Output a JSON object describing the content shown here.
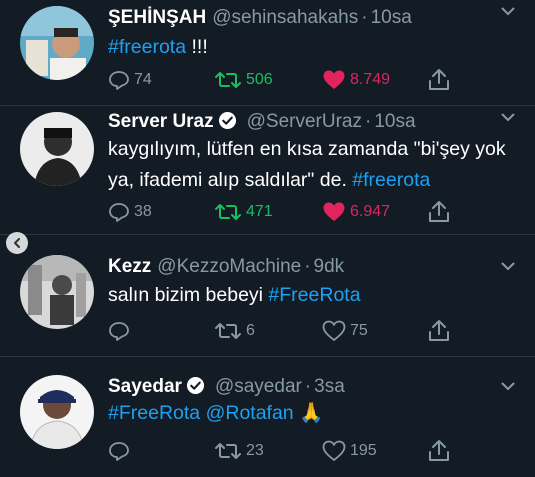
{
  "tweets": [
    {
      "name": "ŞEHİNŞAH",
      "handle": "@sehinsahakahs",
      "sep": "·",
      "time": "10sa",
      "verified": false,
      "text_plain": "",
      "text_tag": "#freerota",
      "text_suffix": " !!!",
      "reply_count": "74",
      "retweet_count": "506",
      "like_count": "8.749",
      "retweeted": true,
      "liked": true
    },
    {
      "name": "Server Uraz",
      "handle": "@ServerUraz",
      "sep": "·",
      "time": "10sa",
      "verified": true,
      "text_plain": "kaygılıyım, lütfen en kısa zamanda \"bi'şey yok ya, ifademi alıp saldılar\" de. ",
      "text_tag": "#freerota",
      "text_suffix": "",
      "reply_count": "38",
      "retweet_count": "471",
      "like_count": "6.947",
      "retweeted": true,
      "liked": true
    },
    {
      "name": "Kezz",
      "handle": "@KezzoMachine",
      "sep": "·",
      "time": "9dk",
      "verified": false,
      "text_plain": "salın bizim bebeyi ",
      "text_tag": "#FreeRota",
      "text_suffix": "",
      "reply_count": "",
      "retweet_count": "6",
      "like_count": "75",
      "retweeted": false,
      "liked": false
    },
    {
      "name": "Sayedar",
      "handle": "@sayedar",
      "sep": "·",
      "time": "3sa",
      "verified": true,
      "text_plain": "",
      "text_tag": "#FreeRota",
      "text_mention": "@Rotafan",
      "text_emoji": "🙏",
      "reply_count": "",
      "retweet_count": "23",
      "like_count": "195",
      "retweeted": false,
      "liked": false
    }
  ],
  "colors": {
    "background": "#131b25",
    "link": "#1da1f2",
    "muted": "#8899a6",
    "retweet_active": "#17bf63",
    "like_active": "#e0245e",
    "verified_badge": "#ffffff"
  },
  "icons": {
    "reply": "reply-icon",
    "retweet": "retweet-icon",
    "like": "heart-icon",
    "share": "share-icon",
    "caret": "chevron-down-icon",
    "verified": "verified-badge-icon",
    "scroll": "chevron-left-icon"
  }
}
